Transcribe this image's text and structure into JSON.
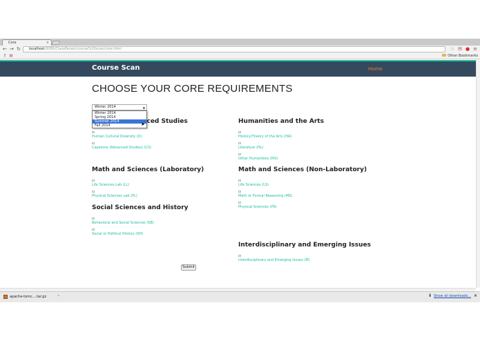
{
  "browser": {
    "tab_title": "Core",
    "url_host": "localhost",
    "url_rest": ":8080/ClassParser/course%20scan/core.html",
    "other_bookmarks": "Other Bookmarks"
  },
  "nav": {
    "brand": "Course Scan",
    "home": "Home"
  },
  "page": {
    "title": "CHOOSE YOUR CORE REQUIREMENTS"
  },
  "term_select": {
    "selected": "Winter 2014",
    "options": [
      "Winter 2014",
      "Spring 2014",
      "Summer 2014",
      "Fall 2014"
    ],
    "highlighted": "Summer 2014"
  },
  "sections": {
    "adv_studies": {
      "title": "anced Studies",
      "links": [
        "Human Cultural Diversity (D)",
        "Capstone (Advanced Studies) (CS)"
      ]
    },
    "humanities": {
      "title": "Humanities and the Arts",
      "links": [
        "History/Theory of the Arts (HA)",
        "Literature (HL)",
        "Other Humanities (HO)"
      ]
    },
    "math_lab": {
      "title": "Math and Sciences (Laboratory)",
      "links": [
        "Life Sciences Lab (LL)",
        "Physical Sciences Lab (PL)"
      ]
    },
    "math_nonlab": {
      "title": "Math and Sciences (Non-Laboratory)",
      "links": [
        "Life Sciences (LS)",
        "Math or Formal Reasoning (MS)",
        "Physical Sciences (PS)"
      ]
    },
    "social": {
      "title": "Social Sciences and History",
      "links": [
        "Behavioral and Social Sciences (SB)",
        "Social or Political History (SH)"
      ]
    },
    "interdisc": {
      "title": "Interdisciplinary and Emerging Issues",
      "links": [
        "Interdisciplinary and Emerging Issues (IE)"
      ]
    }
  },
  "submit_label": "Submit",
  "downloads": {
    "file": "apache-tomc....tar.gz",
    "show_all": "Show all downloads..."
  },
  "colors": {
    "navbar": "#34495e",
    "accent": "#1abc9c",
    "home": "#e67e22",
    "link": "#18bc9c"
  }
}
